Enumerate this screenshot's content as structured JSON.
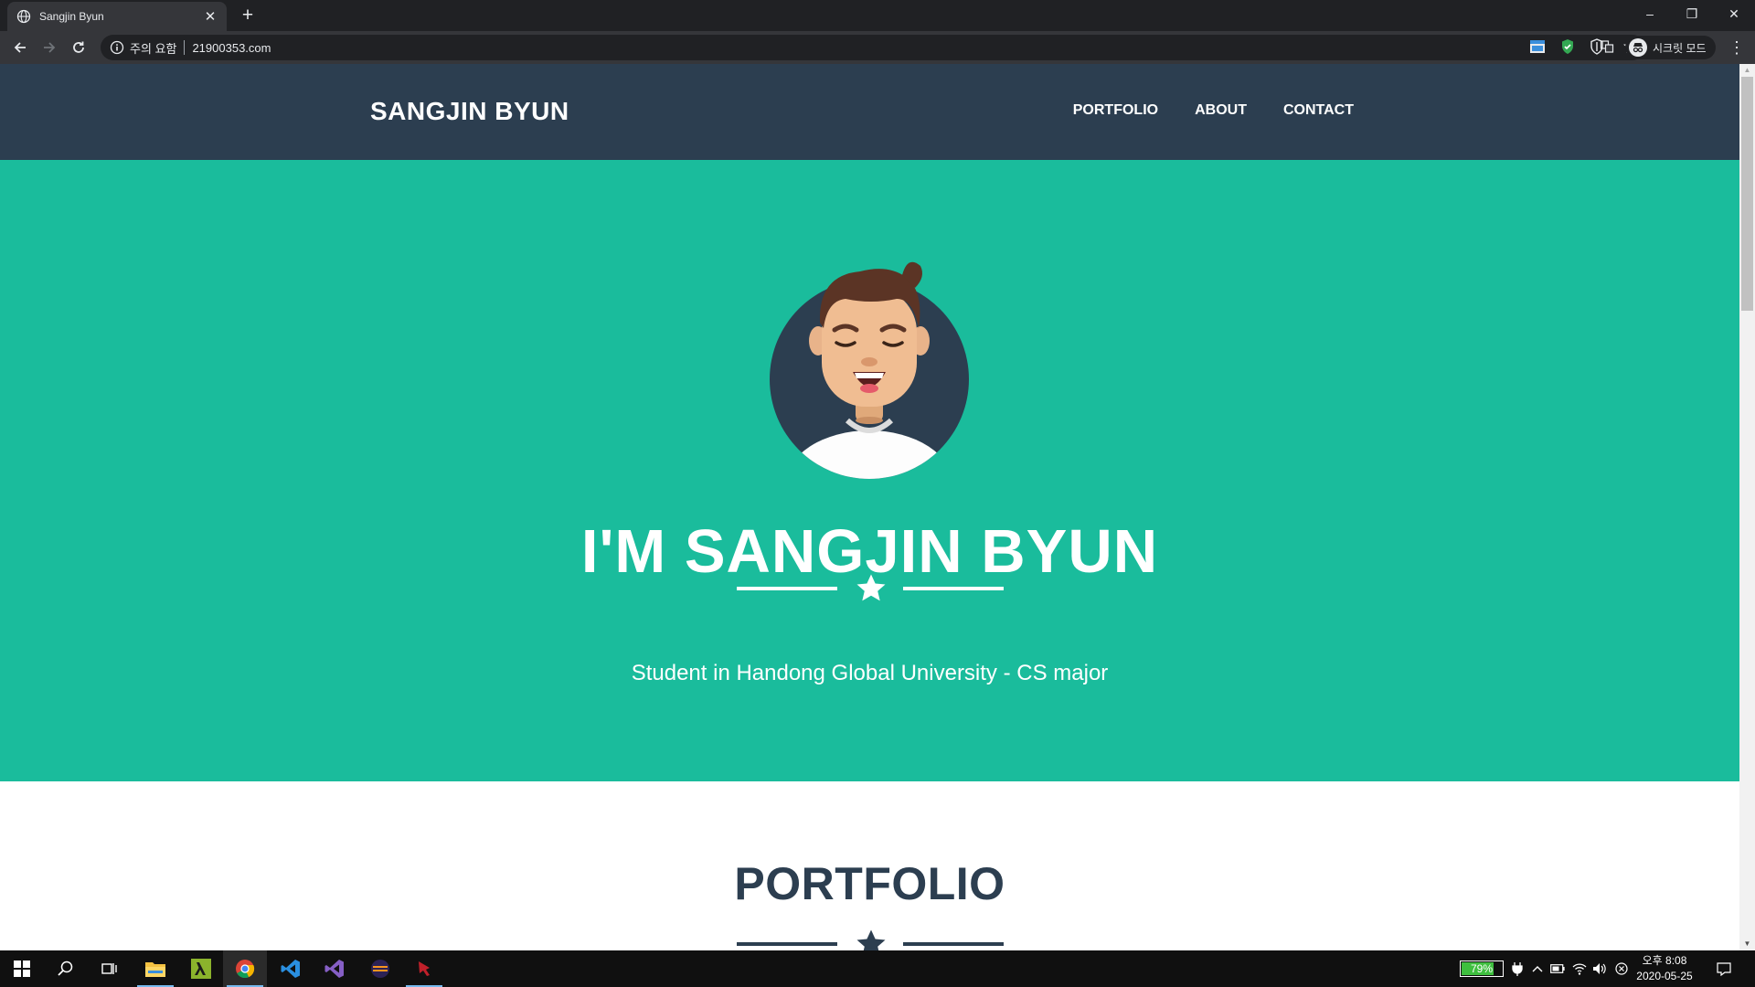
{
  "browser": {
    "tab_title": "Sangjin Byun",
    "tab_close": "✕",
    "new_tab": "+",
    "security_label": "주의 요함",
    "url": "21900353.com",
    "profile_label": "시크릿 모드",
    "window_controls": [
      "–",
      "❐",
      "✕"
    ]
  },
  "site": {
    "brand": "SANGJIN BYUN",
    "nav": [
      {
        "label": "PORTFOLIO"
      },
      {
        "label": "ABOUT"
      },
      {
        "label": "CONTACT"
      }
    ],
    "hero": {
      "title": "I'M SANGJIN BYUN",
      "subtitle": "Student in Handong Global University - CS major"
    },
    "portfolio_title": "PORTFOLIO",
    "colors": {
      "navbar": "#2c3e50",
      "hero": "#1abc9c",
      "heading": "#2c3e50"
    }
  },
  "taskbar": {
    "apps": [
      "start-icon",
      "search-icon",
      "task-view-icon",
      "file-explorer-icon",
      "lambda-app-icon",
      "chrome-icon",
      "vscode-icon",
      "visual-studio-icon",
      "eclipse-icon",
      "app-icon"
    ],
    "battery_text": "79%",
    "battery_level": 0.79,
    "clock_time": "오후 8:08",
    "clock_date": "2020-05-25"
  }
}
